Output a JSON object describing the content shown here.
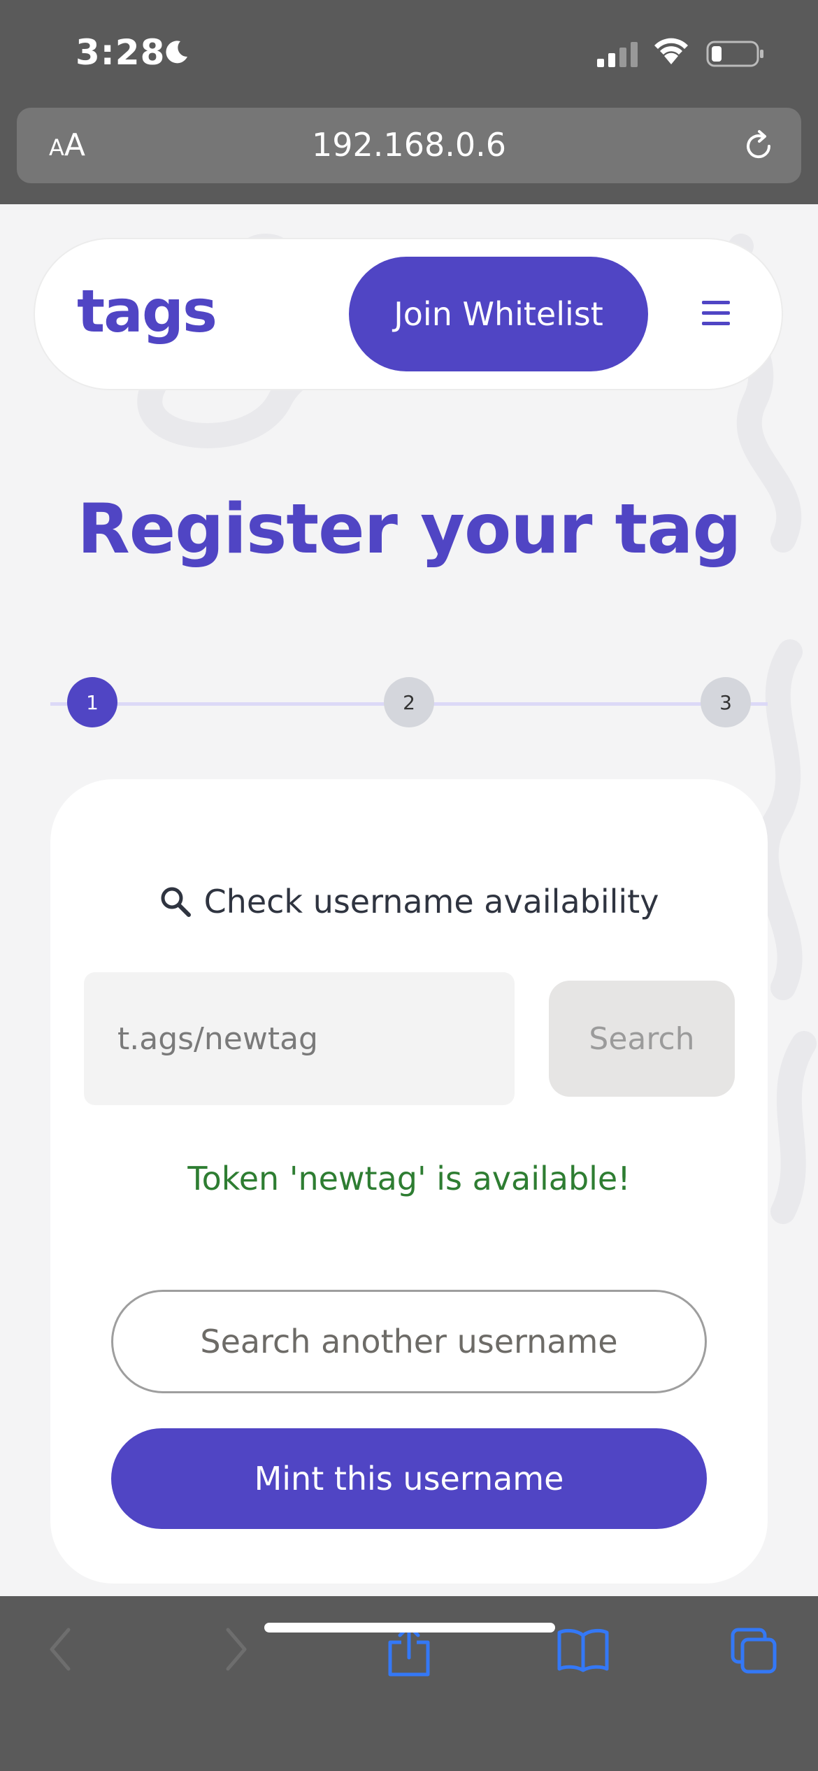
{
  "status_bar": {
    "time": "3:28"
  },
  "browser": {
    "text_size_small": "A",
    "text_size_large": "A",
    "url": "192.168.0.6"
  },
  "header": {
    "logo": "tags",
    "join_button": "Join Whitelist"
  },
  "page": {
    "title": "Register your tag"
  },
  "stepper": {
    "steps": [
      "1",
      "2",
      "3"
    ],
    "current_step": 1
  },
  "form": {
    "check_label": "Check username availability",
    "search_value": "t.ags/newtag",
    "search_button": "Search",
    "status_message": "Token 'newtag' is available!",
    "another_button": "Search another username",
    "mint_button": "Mint this username"
  },
  "colors": {
    "brand": "#5045c4",
    "success": "#2e7d32",
    "chrome": "#5a5a5a",
    "ios_blue": "#3478f6"
  }
}
